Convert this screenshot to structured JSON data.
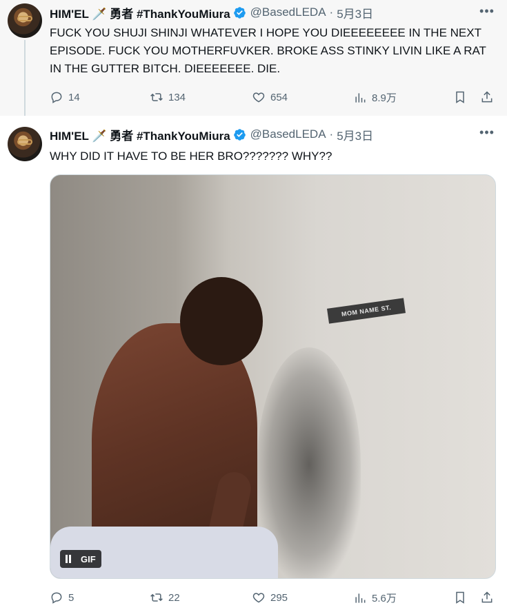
{
  "tweets": [
    {
      "display_name": "HIM'EL 🗡️ 勇者 #ThankYouMiura",
      "handle": "@BasedLEDA",
      "separator": "·",
      "date": "5月3日",
      "text": "FUCK YOU SHUJI SHINJI WHATEVER I HOPE YOU DIEEEEEEEE IN THE NEXT EPISODE. FUCK YOU MOTHERFUVKER. BROKE ASS STINKY LIVIN LIKE A RAT IN THE GUTTER BITCH. DIEEEEEEE. DIE.",
      "stats": {
        "replies": "14",
        "retweets": "134",
        "likes": "654",
        "views": "8.9万"
      }
    },
    {
      "display_name": "HIM'EL 🗡️ 勇者 #ThankYouMiura",
      "handle": "@BasedLEDA",
      "separator": "·",
      "date": "5月3日",
      "text": "WHY DID IT HAVE TO BE HER BRO??????? WHY??",
      "media": {
        "badge": "GIF",
        "sign_text": "MOM NAME ST."
      },
      "stats": {
        "replies": "5",
        "retweets": "22",
        "likes": "295",
        "views": "5.6万"
      }
    }
  ],
  "colors": {
    "verified": "#1d9bf0",
    "muted": "#536471",
    "text": "#0f1419",
    "thread_bg": "#f7f7f7"
  },
  "icons": [
    "reply-icon",
    "retweet-icon",
    "like-icon",
    "views-icon",
    "bookmark-icon",
    "share-icon",
    "more-icon",
    "verified-icon"
  ]
}
